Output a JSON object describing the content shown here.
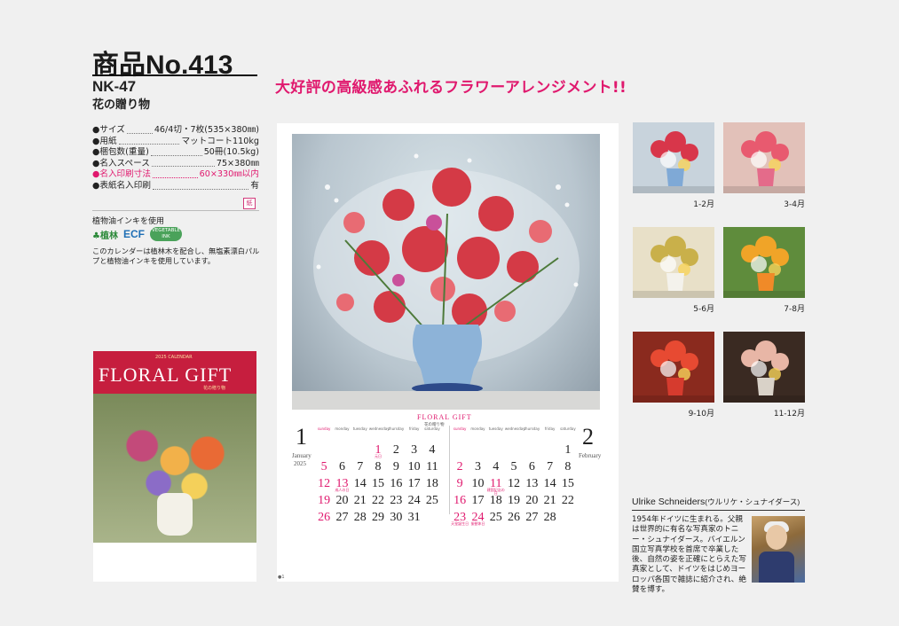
{
  "header": {
    "product_no": "商品No.413",
    "code": "NK-47",
    "name": "花の贈り物",
    "headline": "大好評の高級感あふれるフラワーアレンジメント!!"
  },
  "specs": [
    {
      "label": "●サイズ",
      "value": "46/4切・7枚(535×380㎜)",
      "highlight": false
    },
    {
      "label": "●用紙",
      "value": "マットコート110kg",
      "highlight": false
    },
    {
      "label": "●梱包数(重量)",
      "value": "50冊(10.5kg)",
      "highlight": false
    },
    {
      "label": "●名入スペース",
      "value": "75×380㎜",
      "highlight": false
    },
    {
      "label": "●名入印刷寸法",
      "value": "60×330㎜以内",
      "highlight": true
    },
    {
      "label": "●表紙名入印刷",
      "value": "有",
      "highlight": false
    }
  ],
  "paper_mark": "紙",
  "eco": {
    "title": "植物油インキを使用",
    "badge1": "植林",
    "badge2": "ECF",
    "badge3": "VEGETABLE INK",
    "note": "このカレンダーは植林木を配合し、無塩素漂白パルプと植物油インキを使用しています。"
  },
  "cover": {
    "title": "FLORAL GIFT",
    "top_line": "2025 CALENDAR",
    "subtitle": "花の贈り物"
  },
  "calendar": {
    "brand": "FLORAL GIFT",
    "brand_sub": "花の贈り物",
    "page_no": "●1",
    "months": [
      {
        "number": "1",
        "name": "January",
        "year": "2025",
        "weekdays": [
          "sunday",
          "monday",
          "tuesday",
          "wednesday",
          "thursday",
          "friday",
          "saturday"
        ],
        "weeks": [
          [
            "",
            "",
            "",
            "1",
            "2",
            "3",
            "4"
          ],
          [
            "5",
            "6",
            "7",
            "8",
            "9",
            "10",
            "11"
          ],
          [
            "12",
            "13",
            "14",
            "15",
            "16",
            "17",
            "18"
          ],
          [
            "19",
            "20",
            "21",
            "22",
            "23",
            "24",
            "25"
          ],
          [
            "26",
            "27",
            "28",
            "29",
            "30",
            "31",
            ""
          ]
        ],
        "holidays": [
          "1",
          "5",
          "12",
          "13",
          "19",
          "26"
        ],
        "holiday_notes": {
          "1": "元日",
          "13": "成人の日"
        }
      },
      {
        "number": "2",
        "name": "February",
        "weekdays": [
          "sunday",
          "monday",
          "tuesday",
          "wednesday",
          "thursday",
          "friday",
          "saturday"
        ],
        "weeks": [
          [
            "",
            "",
            "",
            "",
            "",
            "",
            "1"
          ],
          [
            "2",
            "3",
            "4",
            "5",
            "6",
            "7",
            "8"
          ],
          [
            "9",
            "10",
            "11",
            "12",
            "13",
            "14",
            "15"
          ],
          [
            "16",
            "17",
            "18",
            "19",
            "20",
            "21",
            "22"
          ],
          [
            "23",
            "24",
            "25",
            "26",
            "27",
            "28",
            ""
          ]
        ],
        "holidays": [
          "2",
          "9",
          "11",
          "16",
          "23",
          "24"
        ],
        "holiday_notes": {
          "11": "建国記念の日",
          "23": "天皇誕生日",
          "24": "振替休日"
        }
      }
    ]
  },
  "thumbnails": [
    {
      "label": "1-2月",
      "bg": "#c8d3dc",
      "flower": "#d8364a",
      "vase": "#7fa9d6"
    },
    {
      "label": "3-4月",
      "bg": "#e2c1b9",
      "flower": "#e85a6f",
      "vase": "#e46b8a"
    },
    {
      "label": "5-6月",
      "bg": "#e8e0c8",
      "flower": "#c9b04a",
      "vase": "#f4f2ec"
    },
    {
      "label": "7-8月",
      "bg": "#5f8c3c",
      "flower": "#f0a428",
      "vase": "#f08a28"
    },
    {
      "label": "9-10月",
      "bg": "#8a2a1e",
      "flower": "#e74a32",
      "vase": "#d63b2e"
    },
    {
      "label": "11-12月",
      "bg": "#3a2a22",
      "flower": "#e8b6a6",
      "vase": "#d9d2c8"
    }
  ],
  "photographer": {
    "name": "Ulrike Schneiders",
    "kana": "(ウルリケ・シュナイダース)",
    "bio": "1954年ドイツに生まれる。父親は世界的に有名な写真家のトニー・シュナイダース。バイエルン国立写真学校を首席で卒業した後、自然の姿を正確にとらえた写真家として、ドイツをはじめヨーロッパ各国で雑誌に紹介され、絶賛を博す。"
  }
}
